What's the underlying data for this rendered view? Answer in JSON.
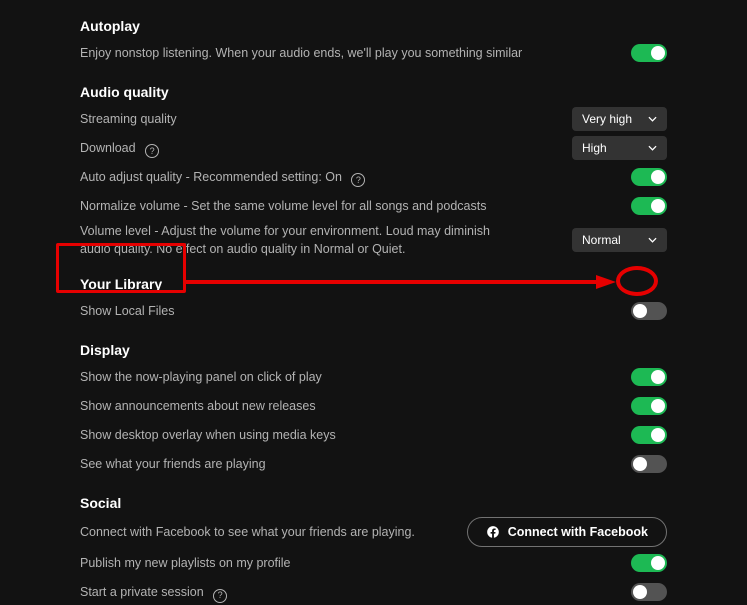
{
  "autoplay": {
    "title": "Autoplay",
    "desc": "Enjoy nonstop listening. When your audio ends, we'll play you something similar",
    "enabled": true
  },
  "audio_quality": {
    "title": "Audio quality",
    "streaming_label": "Streaming quality",
    "streaming_value": "Very high",
    "download_label": "Download",
    "download_value": "High",
    "auto_adjust_label": "Auto adjust quality - Recommended setting: On",
    "auto_adjust_enabled": true,
    "normalize_label": "Normalize volume - Set the same volume level for all songs and podcasts",
    "normalize_enabled": true,
    "volume_level_label": "Volume level - Adjust the volume for your environment. Loud may diminish audio quality. No effect on audio quality in Normal or Quiet.",
    "volume_level_value": "Normal"
  },
  "library": {
    "title": "Your Library",
    "show_local_label": "Show Local Files",
    "show_local_enabled": false
  },
  "display": {
    "title": "Display",
    "now_playing_label": "Show the now-playing panel on click of play",
    "now_playing_enabled": true,
    "announcements_label": "Show announcements about new releases",
    "announcements_enabled": true,
    "overlay_label": "Show desktop overlay when using media keys",
    "overlay_enabled": true,
    "friends_label": "See what your friends are playing",
    "friends_enabled": false
  },
  "social": {
    "title": "Social",
    "fb_desc": "Connect with Facebook to see what your friends are playing.",
    "fb_button": "Connect with Facebook",
    "publish_label": "Publish my new playlists on my profile",
    "publish_enabled": true,
    "private_label": "Start a private session",
    "private_enabled": false
  }
}
